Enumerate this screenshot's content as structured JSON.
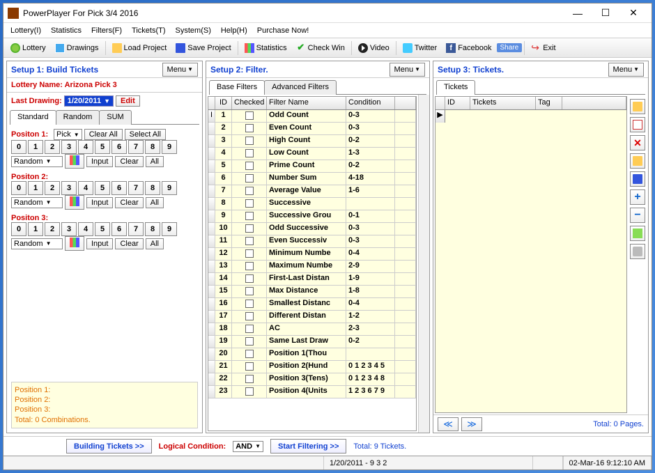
{
  "title": "PowerPlayer For Pick 3/4 2016",
  "menubar": [
    "Lottery(I)",
    "Statistics",
    "Filters(F)",
    "Tickets(T)",
    "System(S)",
    "Help(H)",
    "Purchase Now!"
  ],
  "toolbar": {
    "lottery": "Lottery",
    "drawings": "Drawings",
    "loadproj": "Load Project",
    "saveproj": "Save Project",
    "statistics": "Statistics",
    "checkwin": "Check Win",
    "video": "Video",
    "twitter": "Twitter",
    "facebook": "Facebook",
    "share": "Share",
    "exit": "Exit"
  },
  "panel1": {
    "title": "Setup 1: Build  Tickets",
    "menu": "Menu",
    "lotname": "Lottery Name: Arizona Pick 3",
    "lastdraw": "Last Drawing:",
    "date": "1/20/2011",
    "edit": "Edit",
    "tabs": [
      "Standard",
      "Random",
      "SUM"
    ],
    "positions": [
      "Positon 1:",
      "Positon 2:",
      "Positon 3:"
    ],
    "pick": "Pick",
    "clearall": "Clear All",
    "selectall": "Select All",
    "nums": [
      "0",
      "1",
      "2",
      "3",
      "4",
      "5",
      "6",
      "7",
      "8",
      "9"
    ],
    "random": "Random",
    "input": "Input",
    "clear": "Clear",
    "all": "All",
    "footer": [
      "Position 1:",
      "Position 2:",
      "Position 3:",
      "Total: 0 Combinations."
    ]
  },
  "panel2": {
    "title": "Setup 2: Filter.",
    "menu": "Menu",
    "tabs": [
      "Base Filters",
      "Advanced Filters"
    ],
    "cols": [
      "ID",
      "Checked",
      "Filter Name",
      "Condition"
    ],
    "rows": [
      {
        "id": "1",
        "name": "Odd Count",
        "cond": "0-3"
      },
      {
        "id": "2",
        "name": "Even Count",
        "cond": "0-3"
      },
      {
        "id": "3",
        "name": "High Count",
        "cond": "0-2"
      },
      {
        "id": "4",
        "name": "Low Count",
        "cond": "1-3"
      },
      {
        "id": "5",
        "name": "Prime Count",
        "cond": "0-2"
      },
      {
        "id": "6",
        "name": "Number Sum",
        "cond": "4-18"
      },
      {
        "id": "7",
        "name": "Average Value",
        "cond": "1-6"
      },
      {
        "id": "8",
        "name": "Successive",
        "cond": ""
      },
      {
        "id": "9",
        "name": "Successive Grou",
        "cond": "0-1"
      },
      {
        "id": "10",
        "name": "Odd Successive",
        "cond": "0-3"
      },
      {
        "id": "11",
        "name": "Even Successiv",
        "cond": "0-3"
      },
      {
        "id": "12",
        "name": "Minimum Numbe",
        "cond": "0-4"
      },
      {
        "id": "13",
        "name": "Maximum Numbe",
        "cond": "2-9"
      },
      {
        "id": "14",
        "name": "First-Last Distan",
        "cond": "1-9"
      },
      {
        "id": "15",
        "name": "Max Distance",
        "cond": "1-8"
      },
      {
        "id": "16",
        "name": "Smallest Distanc",
        "cond": "0-4"
      },
      {
        "id": "17",
        "name": "Different Distan",
        "cond": "1-2"
      },
      {
        "id": "18",
        "name": "AC",
        "cond": "2-3"
      },
      {
        "id": "19",
        "name": "Same Last Draw",
        "cond": "0-2"
      },
      {
        "id": "20",
        "name": "Position 1(Thou",
        "cond": ""
      },
      {
        "id": "21",
        "name": "Position 2(Hund",
        "cond": "0 1 2 3 4 5 "
      },
      {
        "id": "22",
        "name": "Position 3(Tens)",
        "cond": "0 1 2 3 4 8"
      },
      {
        "id": "23",
        "name": "Position 4(Units",
        "cond": "1 2 3 6 7 9"
      }
    ]
  },
  "panel3": {
    "title": "Setup 3: Tickets.",
    "menu": "Menu",
    "tab": "Tickets",
    "cols": [
      "ID",
      "Tickets",
      "Tag"
    ],
    "pages": "Total: 0 Pages."
  },
  "bottom": {
    "build": "Building Tickets >>",
    "logcond": "Logical Condition:",
    "and": "AND",
    "start": "Start Filtering  >>",
    "total": "Total: 9 Tickets."
  },
  "status": {
    "mid": "1/20/2011 - 9 3 2",
    "dt": "02-Mar-16 9:12:10 AM"
  }
}
